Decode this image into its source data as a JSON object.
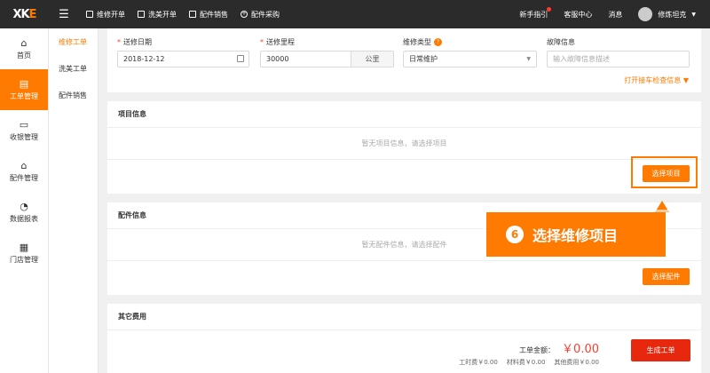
{
  "topbar": {
    "logo": "XK",
    "nav": [
      {
        "label": "维修开单",
        "icon": "document-icon"
      },
      {
        "label": "洗美开单",
        "icon": "document-icon"
      },
      {
        "label": "配件销售",
        "icon": "document-icon"
      },
      {
        "label": "配件采购",
        "icon": "plus-circle-icon"
      }
    ],
    "guide": "新手指引",
    "support": "客服中心",
    "messages": "消息",
    "user": "修炼坦克"
  },
  "sidebar": {
    "items": [
      {
        "label": "首页",
        "icon": "home-icon"
      },
      {
        "label": "工单管理",
        "icon": "clipboard-icon",
        "active": true
      },
      {
        "label": "收银管理",
        "icon": "cash-icon"
      },
      {
        "label": "配件管理",
        "icon": "warehouse-icon"
      },
      {
        "label": "数据报表",
        "icon": "pie-chart-icon"
      },
      {
        "label": "门店管理",
        "icon": "store-icon"
      }
    ]
  },
  "subnav": {
    "items": [
      {
        "label": "维修工单",
        "active": true
      },
      {
        "label": "洗美工单"
      },
      {
        "label": "配件销售"
      }
    ]
  },
  "form": {
    "date_label": "送修日期",
    "date_value": "2018-12-12",
    "mileage_label": "送修里程",
    "mileage_value": "30000",
    "mileage_unit": "公里",
    "type_label": "维修类型",
    "type_value": "日常维护",
    "fault_label": "故障信息",
    "fault_placeholder": "输入故障信息描述",
    "inspection_link": "打开接车检查信息"
  },
  "project": {
    "title": "项目信息",
    "empty": "暂无项目信息，请选择项目",
    "button": "选择项目"
  },
  "parts": {
    "title": "配件信息",
    "empty": "暂无配件信息，请选择配件",
    "button": "选择配件"
  },
  "callout": {
    "number": "6",
    "text": "选择维修项目"
  },
  "other": {
    "title": "其它费用",
    "total_label": "工单金额：",
    "total_value": "￥0.00",
    "labor": "工时费￥0.00",
    "material": "材料费￥0.00",
    "other_fee": "其他费用￥0.00",
    "submit": "生成工单"
  },
  "colors": {
    "accent": "#ff7a00",
    "topbar": "#2b2b2b",
    "danger": "#e8270f"
  }
}
